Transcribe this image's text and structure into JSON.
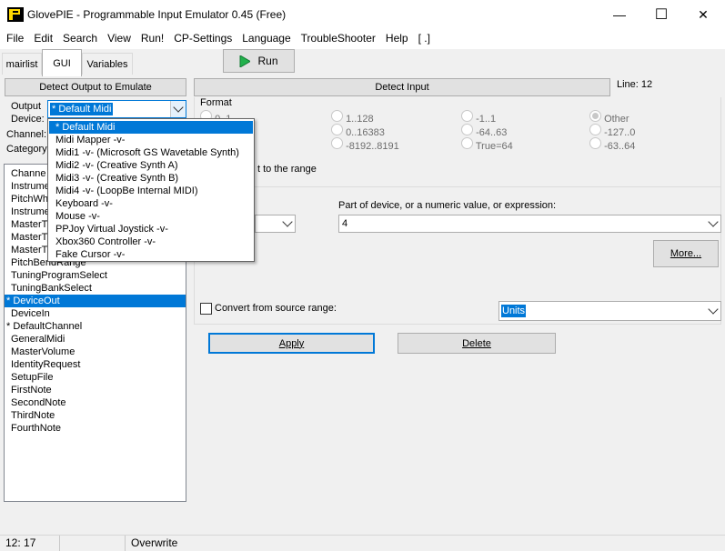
{
  "window": {
    "title": "GlovePIE - Programmable Input Emulator 0.45 (Free)",
    "minimize_glyph": "—",
    "maximize_glyph": "☐",
    "close_glyph": "✕"
  },
  "menu": [
    "File",
    "Edit",
    "Search",
    "View",
    "Run!",
    "CP-Settings",
    "Language",
    "TroubleShooter",
    "Help",
    "[ .]"
  ],
  "tabs": [
    "mairlist",
    "GUI",
    "Variables"
  ],
  "active_tab": "GUI",
  "run_button": {
    "label": "Run",
    "icon": "play-icon",
    "icon_color": "#22b14c"
  },
  "left": {
    "detect_output_label": "Detect Output to Emulate",
    "output_label": "Output",
    "device_label": "Device:",
    "device_value": "* Default Midi",
    "channel_label": "Channel:",
    "category_label": "Category:",
    "items": [
      "Channe",
      "Instrume",
      "PitchWh",
      "Instrume",
      "MasterT",
      "MasterT",
      "MasterT",
      "PitchBendRange",
      "TuningProgramSelect",
      "TuningBankSelect",
      "* DeviceOut",
      "DeviceIn",
      "* DefaultChannel",
      "GeneralMidi",
      "MasterVolume",
      "IdentityRequest",
      "SetupFile",
      "FirstNote",
      "SecondNote",
      "ThirdNote",
      "FourthNote"
    ],
    "selected_item": "* DeviceOut"
  },
  "dropdown": {
    "options": [
      "* Default Midi",
      "Midi Mapper -v-",
      "Midi1 -v- (Microsoft GS Wavetable Synth)",
      "Midi2 -v- (Creative Synth A)",
      "Midi3 -v- (Creative Synth B)",
      "Midi4 -v- (LoopBe Internal MIDI)",
      "Keyboard -v-",
      "Mouse -v-",
      "PPJoy Virtual Joystick -v-",
      "Xbox360 Controller -v-",
      "Fake Cursor -v-"
    ],
    "selected": "* Default Midi"
  },
  "right": {
    "detect_input_label": "Detect Input",
    "line_label": "Line: 12",
    "format_label": "Format",
    "radios": [
      {
        "label": "0..1",
        "checked": false
      },
      {
        "label": "1..128",
        "checked": false
      },
      {
        "label": "-1..1",
        "checked": false
      },
      {
        "label": "Other",
        "checked": true
      },
      {
        "label": "",
        "checked": false
      },
      {
        "label": "0..16383",
        "checked": false
      },
      {
        "label": "-64..63",
        "checked": false
      },
      {
        "label": "-127..0",
        "checked": false
      },
      {
        "label": "",
        "checked": false
      },
      {
        "label": "-8192..8191",
        "checked": false
      },
      {
        "label": "True=64",
        "checked": false
      },
      {
        "label": "-63..64",
        "checked": false
      }
    ],
    "range_text": "t to the range",
    "part_label": "Part of device,  or a numeric value, or expression:",
    "part_value": "4",
    "more_label": "More...",
    "convert_label": "Convert from source range:",
    "units_value": "Units",
    "apply_label": "Apply",
    "delete_label": "Delete"
  },
  "status": {
    "position": "12:  17",
    "mode": "Overwrite"
  },
  "colors": {
    "selection": "#0078d7",
    "panel": "#f0f0f0",
    "button": "#e1e1e1"
  }
}
